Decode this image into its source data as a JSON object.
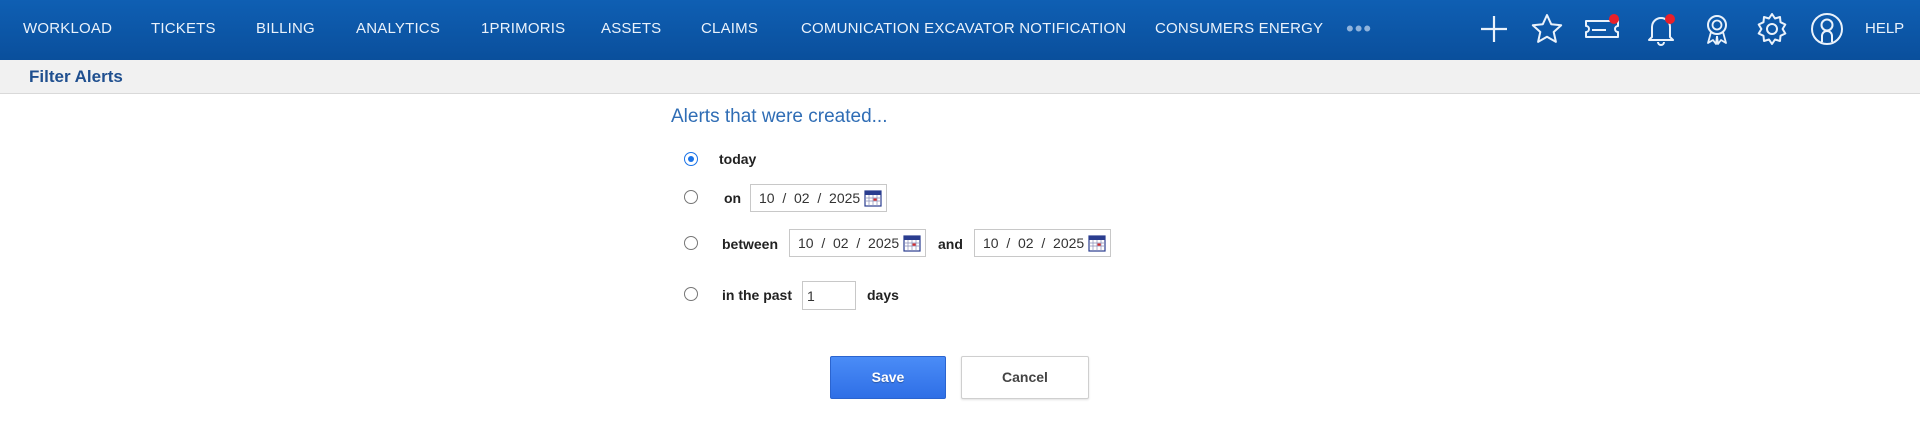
{
  "nav": {
    "items": [
      {
        "label": "WORKLOAD"
      },
      {
        "label": "TICKETS"
      },
      {
        "label": "BILLING"
      },
      {
        "label": "ANALYTICS"
      },
      {
        "label": "1PRIMORIS"
      },
      {
        "label": "ASSETS"
      },
      {
        "label": "CLAIMS"
      },
      {
        "label": "COMUNICATION EXCAVATOR NOTIFICATION"
      },
      {
        "label": "CONSUMERS ENERGY"
      }
    ],
    "more_label": "•••",
    "icons": [
      "plus-icon",
      "star-icon",
      "ticket-icon",
      "bell-icon",
      "award-icon",
      "gear-icon",
      "user-icon"
    ],
    "help_label": "HELP",
    "badge_color": "#e8202a"
  },
  "subheader": {
    "title": "Filter Alerts"
  },
  "filter": {
    "heading": "Alerts that were created...",
    "options": {
      "today": {
        "label": "today",
        "checked": true
      },
      "on": {
        "label": "on",
        "date": "10  /  02  /  2025"
      },
      "between": {
        "label": "between",
        "start_date": "10  /  02  /  2025",
        "and_label": "and",
        "end_date": "10  /  02  /  2025"
      },
      "past": {
        "label": "in the past",
        "days_value": "1",
        "days_label": "days"
      }
    }
  },
  "buttons": {
    "save": "Save",
    "cancel": "Cancel"
  },
  "colors": {
    "nav_bg": "#0a55a6",
    "accent": "#2f6fe6",
    "title": "#1f4f8f"
  }
}
